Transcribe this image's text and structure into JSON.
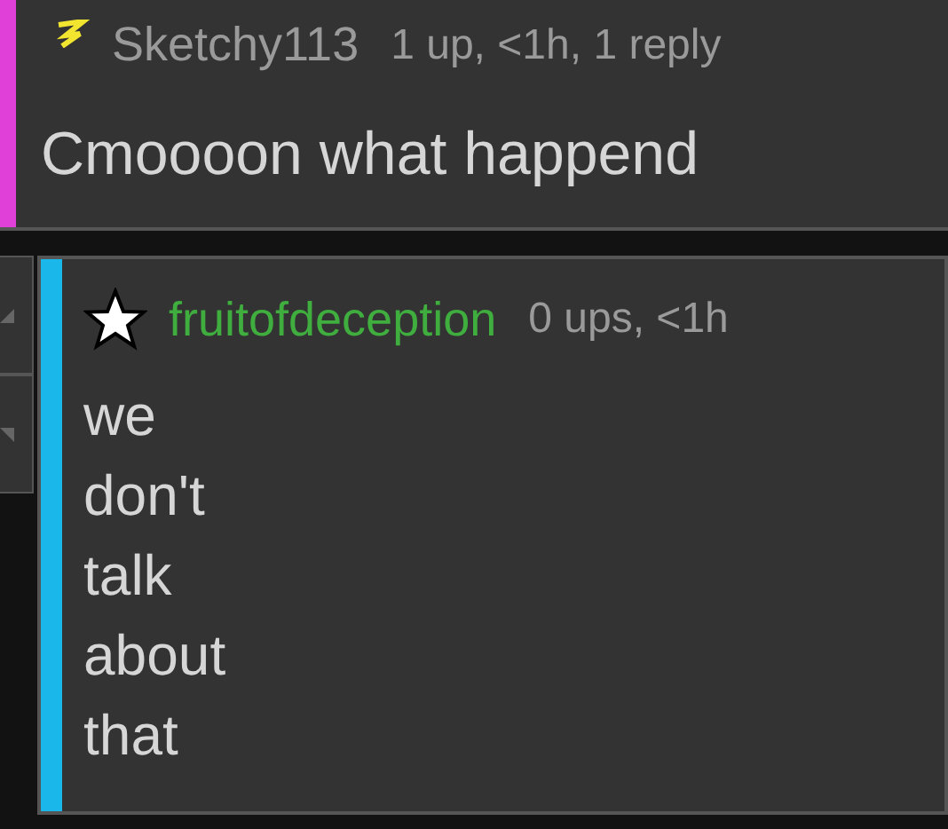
{
  "comments": [
    {
      "username": "Sketchy113",
      "meta": "1 up, <1h, 1 reply",
      "text": "Cmoooon what happend",
      "color": "#e040d8",
      "kind": "bolt"
    },
    {
      "username": "fruitofdeception",
      "meta": "0 ups, <1h",
      "text": "we\ndon't\ntalk\nabout\nthat",
      "color": "#1ab8ea",
      "kind": "star"
    }
  ]
}
